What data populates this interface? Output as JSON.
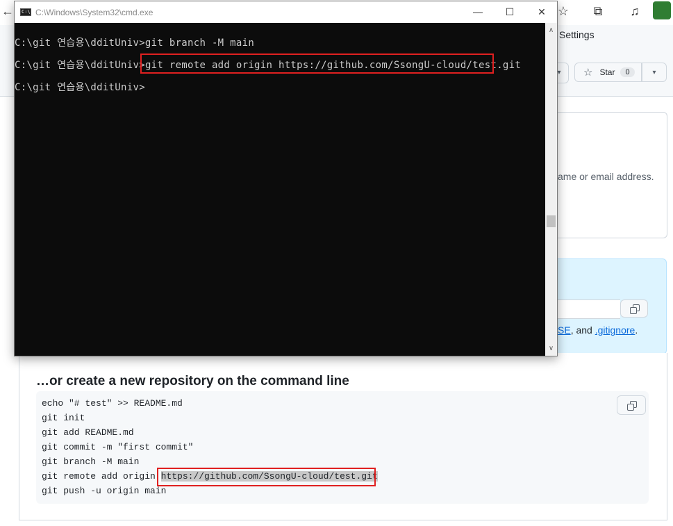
{
  "browser": {
    "settings_tab": "Settings",
    "star_label": "Star",
    "star_count": "0",
    "invite_text": "ame or email address.",
    "quick_text_prefix": "SE",
    "quick_text_mid": ", and ",
    "quick_text_link": ".gitignore",
    "quick_text_end": "."
  },
  "command_line_section": {
    "title": "…or create a new repository on the command line",
    "lines": [
      "echo \"# test\" >> README.md",
      "git init",
      "git add README.md",
      "git commit -m \"first commit\"",
      "git branch -M main",
      "git remote add origin ",
      "git push -u origin main"
    ],
    "remote_url": "https://github.com/SsongU-cloud/test.git"
  },
  "cmd": {
    "title": "C:\\Windows\\System32\\cmd.exe",
    "icon_text": "C:\\",
    "minimize": "—",
    "maximize": "☐",
    "close": "✕",
    "lines": [
      "C:\\git 연습용\\dditUniv>git branch -M main",
      "C:\\git 연습용\\dditUniv>",
      "C:\\git 연습용\\dditUniv>"
    ],
    "highlighted_command": "git remote add origin https://github.com/SsongU-cloud/test.git"
  },
  "colors": {
    "highlight_border": "#e02020",
    "link": "#0969da"
  }
}
